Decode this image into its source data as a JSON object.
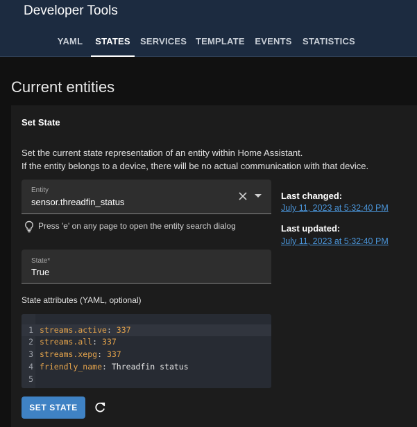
{
  "header": {
    "title": "Developer Tools",
    "tabs": [
      {
        "label": "YAML"
      },
      {
        "label": "STATES"
      },
      {
        "label": "SERVICES"
      },
      {
        "label": "TEMPLATE"
      },
      {
        "label": "EVENTS"
      },
      {
        "label": "STATISTICS"
      }
    ]
  },
  "page": {
    "title": "Current entities"
  },
  "set_state": {
    "title": "Set State",
    "description_line1": "Set the current state representation of an entity within Home Assistant.",
    "description_line2": "If the entity belongs to a device, there will be no actual communication with that device.",
    "entity_field": {
      "label": "Entity",
      "value": "sensor.threadfin_status"
    },
    "hint": "Press 'e' on any page to open the entity search dialog",
    "state_field": {
      "label": "State*",
      "value": "True"
    },
    "attributes_label": "State attributes (YAML, optional)",
    "editor": {
      "lines": [
        {
          "num": "1",
          "key": "streams.active",
          "sep": ": ",
          "value": "337"
        },
        {
          "num": "2",
          "key": "streams.all",
          "sep": ": ",
          "value": "337"
        },
        {
          "num": "3",
          "key": "streams.xepg",
          "sep": ": ",
          "value": "337"
        },
        {
          "num": "4",
          "key": "friendly_name",
          "sep": ": ",
          "value": "Threadfin status"
        },
        {
          "num": "5",
          "key": "",
          "sep": "",
          "value": ""
        }
      ]
    },
    "button_label": "SET STATE"
  },
  "meta": {
    "last_changed_label": "Last changed:",
    "last_changed_value": "July 11, 2023 at 5:32:40 PM",
    "last_updated_label": "Last updated:",
    "last_updated_value": "July 11, 2023 at 5:32:40 PM"
  },
  "colors": {
    "header_bg": "#1c2b40",
    "accent": "#3f82c4",
    "link": "#4a94d8",
    "yaml_key": "#e5a44c"
  },
  "icons": [
    "clear-icon",
    "dropdown-icon",
    "lightbulb-icon",
    "refresh-icon"
  ]
}
